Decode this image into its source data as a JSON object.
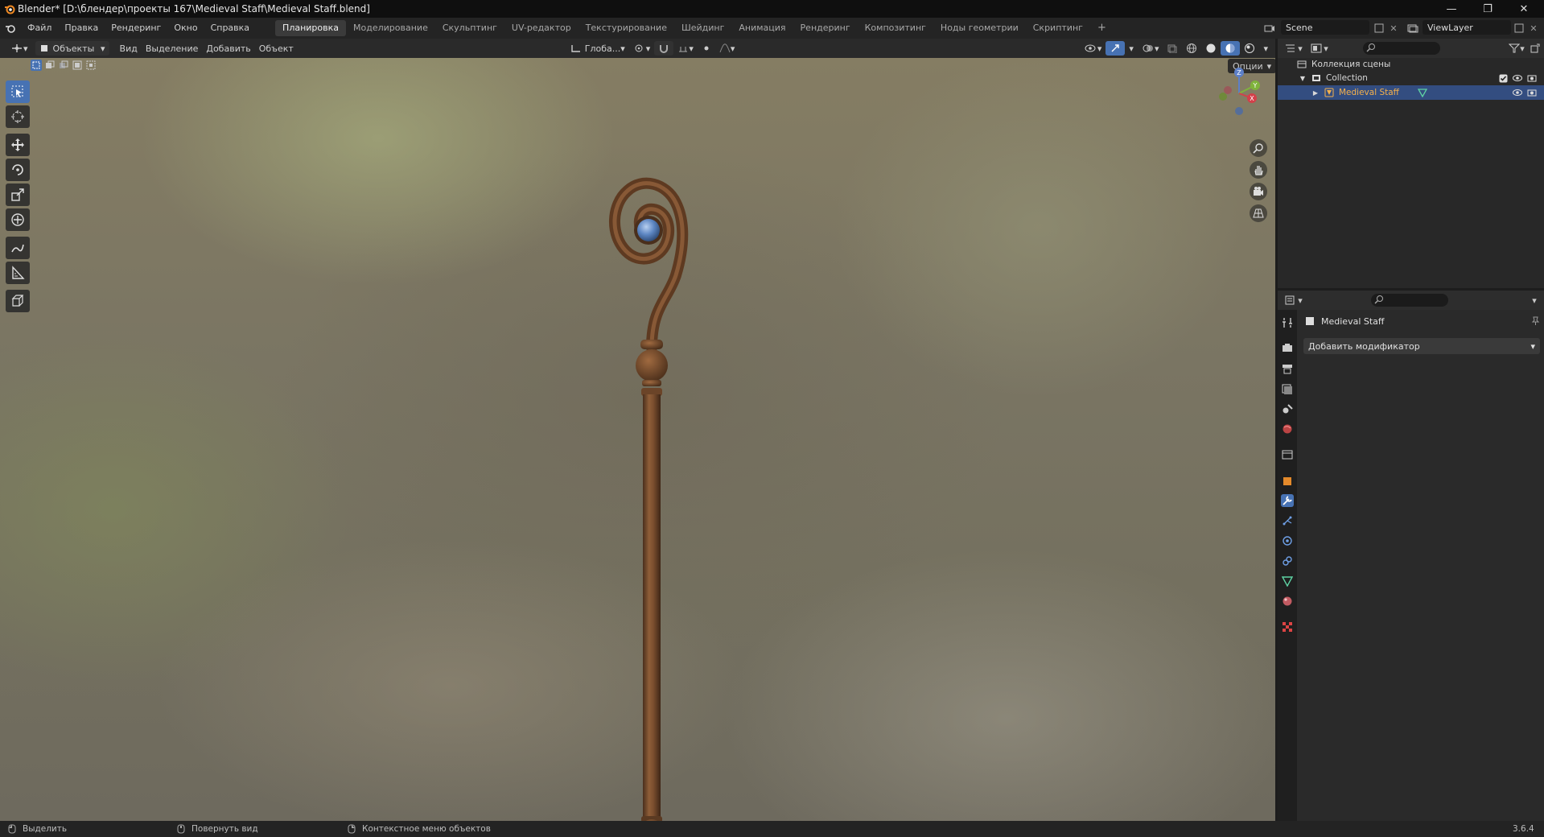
{
  "window": {
    "title": "Blender* [D:\\блендер\\проекты 167\\Medieval Staff\\Medieval Staff.blend]",
    "controls": [
      "—",
      "❐",
      "✕"
    ]
  },
  "menu": [
    "Файл",
    "Правка",
    "Рендеринг",
    "Окно",
    "Справка"
  ],
  "workspaces": [
    "Планировка",
    "Моделирование",
    "Скульптинг",
    "UV-редактор",
    "Текстурирование",
    "Шейдинг",
    "Анимация",
    "Рендеринг",
    "Композитинг",
    "Ноды геометрии",
    "Скриптинг"
  ],
  "active_workspace": "Планировка",
  "add_workspace": "+",
  "scene": {
    "name": "Scene",
    "view_layer": "ViewLayer"
  },
  "viewport_header": {
    "mode": "Объекты",
    "menus": [
      "Вид",
      "Выделение",
      "Добавить",
      "Объект"
    ],
    "orientation": "Глоба...",
    "options": "Опции"
  },
  "gizmo": {
    "x": "X",
    "y": "Y",
    "z": "Z"
  },
  "outliner": {
    "scene_collection": "Коллекция сцены",
    "collection": "Collection",
    "object": "Medieval Staff"
  },
  "properties": {
    "object_name": "Medieval Staff",
    "add_modifier": "Добавить модификатор"
  },
  "statusbar": {
    "select": "Выделить",
    "rotate": "Повернуть вид",
    "context": "Контекстное меню объектов",
    "version": "3.6.4"
  },
  "colors": {
    "accent": "#4772b3",
    "selected_row": "#334d80",
    "object_text": "#f5b14b",
    "staff_wood": "#8a5a34",
    "orb": "#5d86c2"
  }
}
